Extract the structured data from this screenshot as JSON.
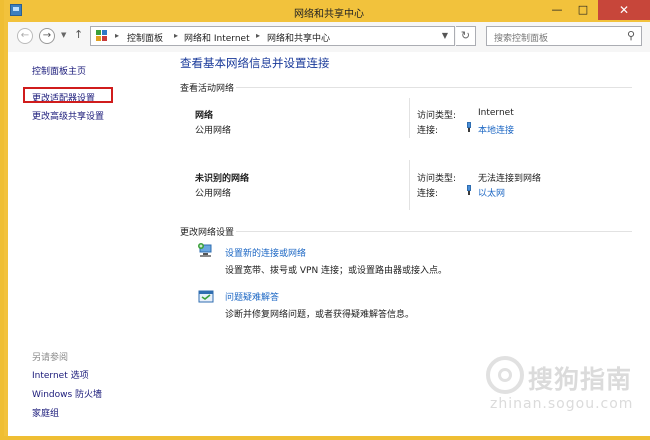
{
  "window": {
    "title": "网络和共享中心"
  },
  "nav": {
    "breadcrumbs": [
      "控制面板",
      "网络和 Internet",
      "网络和共享中心"
    ],
    "search_placeholder": "搜索控制面板"
  },
  "sidebar": {
    "items": [
      "控制面板主页",
      "更改适配器设置",
      "更改高级共享设置"
    ],
    "see_also_heading": "另请参阅",
    "see_also": [
      "Internet 选项",
      "Windows 防火墙",
      "家庭组"
    ]
  },
  "main": {
    "heading": "查看基本网络信息并设置连接",
    "active_networks_heading": "查看活动网络",
    "networks": [
      {
        "name": "网络",
        "type": "公用网络",
        "access_label": "访问类型:",
        "access_value": "Internet",
        "conn_label": "连接:",
        "conn_value": "本地连接"
      },
      {
        "name": "未识别的网络",
        "type": "公用网络",
        "access_label": "访问类型:",
        "access_value": "无法连接到网络",
        "conn_label": "连接:",
        "conn_value": "以太网"
      }
    ],
    "change_heading": "更改网络设置",
    "tasks": [
      {
        "title": "设置新的连接或网络",
        "desc": "设置宽带、拨号或 VPN 连接；或设置路由器或接入点。"
      },
      {
        "title": "问题疑难解答",
        "desc": "诊断并修复网络问题，或者获得疑难解答信息。"
      }
    ]
  },
  "watermark": {
    "text": "搜狗指南",
    "url": "zhinan.sogou.com"
  },
  "colors": {
    "title_bar": "#f2c23c",
    "link": "#1c67c4",
    "heading": "#1a3a9a",
    "highlight": "#d01c1c",
    "close": "#c7463a"
  }
}
